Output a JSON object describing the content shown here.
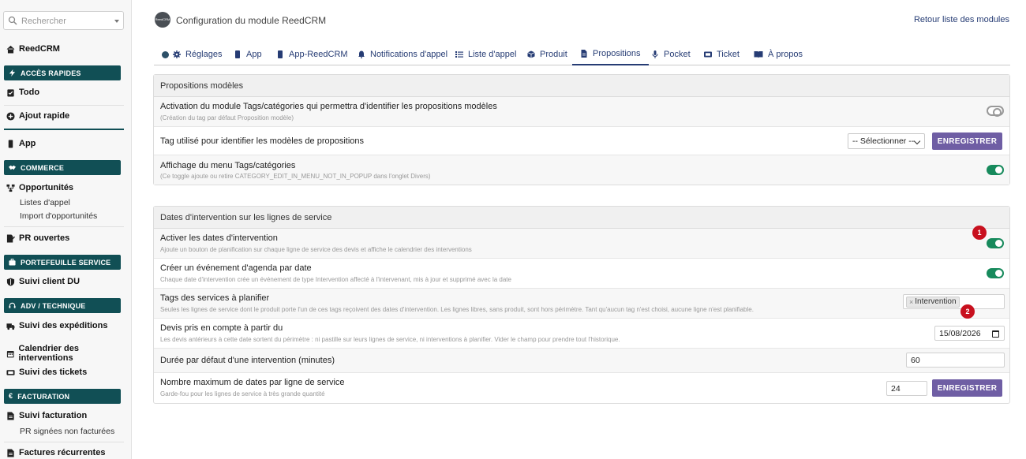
{
  "sidebar": {
    "search_placeholder": "Rechercher",
    "brand": "ReedCRM",
    "sections": {
      "acces": "ACCÈS RAPIDES",
      "commerce": "COMMERCE",
      "portefeuille": "PORTEFEUILLE SERVICE",
      "adv": "ADV / TECHNIQUE",
      "facturation": "FACTURATION"
    },
    "items": {
      "todo": "Todo",
      "ajout": "Ajout rapide",
      "app": "App",
      "opportunites": "Opportunités",
      "listes_appel": "Listes d'appel",
      "import_opp": "Import d'opportunités",
      "pr_ouvertes": "PR ouvertes",
      "suivi_client": "Suivi client DU",
      "suivi_exp": "Suivi des expéditions",
      "calendrier": "Calendrier des interventions",
      "suivi_tickets": "Suivi des tickets",
      "suivi_fact": "Suivi facturation",
      "pr_signees": "PR signées non facturées",
      "factures_rec": "Factures récurrentes"
    }
  },
  "header": {
    "logo_text": "ReedCRM",
    "title": "Configuration du module ReedCRM",
    "back_link": "Retour liste des modules"
  },
  "tabs": [
    {
      "label": "Réglages",
      "icon": "gear-icon"
    },
    {
      "label": "App",
      "icon": "mobile-icon"
    },
    {
      "label": "App-ReedCRM",
      "icon": "mobile-icon"
    },
    {
      "label": "Notifications d'appel",
      "icon": "bell-icon"
    },
    {
      "label": "Liste d'appel",
      "icon": "list-icon"
    },
    {
      "label": "Produit",
      "icon": "box-icon"
    },
    {
      "label": "Propositions",
      "icon": "file-icon"
    },
    {
      "label": "Pocket",
      "icon": "microphone-icon"
    },
    {
      "label": "Ticket",
      "icon": "ticket-icon"
    },
    {
      "label": "À propos",
      "icon": "book-icon"
    }
  ],
  "active_tab": "Propositions",
  "panel1": {
    "title": "Propositions modèles",
    "row1_label": "Activation du module Tags/catégories qui permettra d'identifier les propositions modèles",
    "row1_desc": "(Création du tag par défaut Proposition modèle)",
    "row2_label": "Tag utilisé pour identifier les modèles de propositions",
    "row2_select": "-- Sélectionner --",
    "row2_button": "ENREGISTRER",
    "row3_label": "Affichage du menu Tags/catégories",
    "row3_desc": "(Ce toggle ajoute ou retire CATEGORY_EDIT_IN_MENU_NOT_IN_POPUP dans l'onglet Divers)",
    "row1_toggle": false,
    "row3_toggle": true
  },
  "panel2": {
    "title": "Dates d'intervention sur les lignes de service",
    "r1_label": "Activer les dates d'intervention",
    "r1_desc": "Ajoute un bouton de planification sur chaque ligne de service des devis et affiche le calendrier des interventions",
    "r1_toggle": true,
    "r2_label": "Créer un événement d'agenda par date",
    "r2_desc": "Chaque date d'intervention crée un événement de type Intervention affecté à l'intervenant, mis à jour et supprimé avec la date",
    "r2_toggle": true,
    "r3_label": "Tags des services à planifier",
    "r3_desc": "Seules les lignes de service dont le produit porte l'un de ces tags reçoivent des dates d'intervention. Les lignes libres, sans produit, sont hors périmètre. Tant qu'aucun tag n'est choisi, aucune ligne n'est planifiable.",
    "r3_tag": "Intervention",
    "r3_tag_remove": "×",
    "r4_label": "Devis pris en compte à partir du",
    "r4_desc": "Les devis antérieurs à cette date sortent du périmètre : ni pastille sur leurs lignes de service, ni interventions à planifier. Vider le champ pour prendre tout l'historique.",
    "r4_date": "15/08/2026",
    "r5_label": "Durée par défaut d'une intervention (minutes)",
    "r5_value": "60",
    "r6_label": "Nombre maximum de dates par ligne de service",
    "r6_desc": "Garde-fou pour les lignes de service à très grande quantité",
    "r6_value": "24",
    "r6_button": "ENREGISTRER"
  },
  "badges": {
    "b1": "1",
    "b2": "2"
  },
  "colors": {
    "sidebar_section": "#114f55",
    "accent": "#263c74",
    "button": "#6f5ea4",
    "toggle_on": "#178a5c",
    "badge": "#c8101e"
  }
}
